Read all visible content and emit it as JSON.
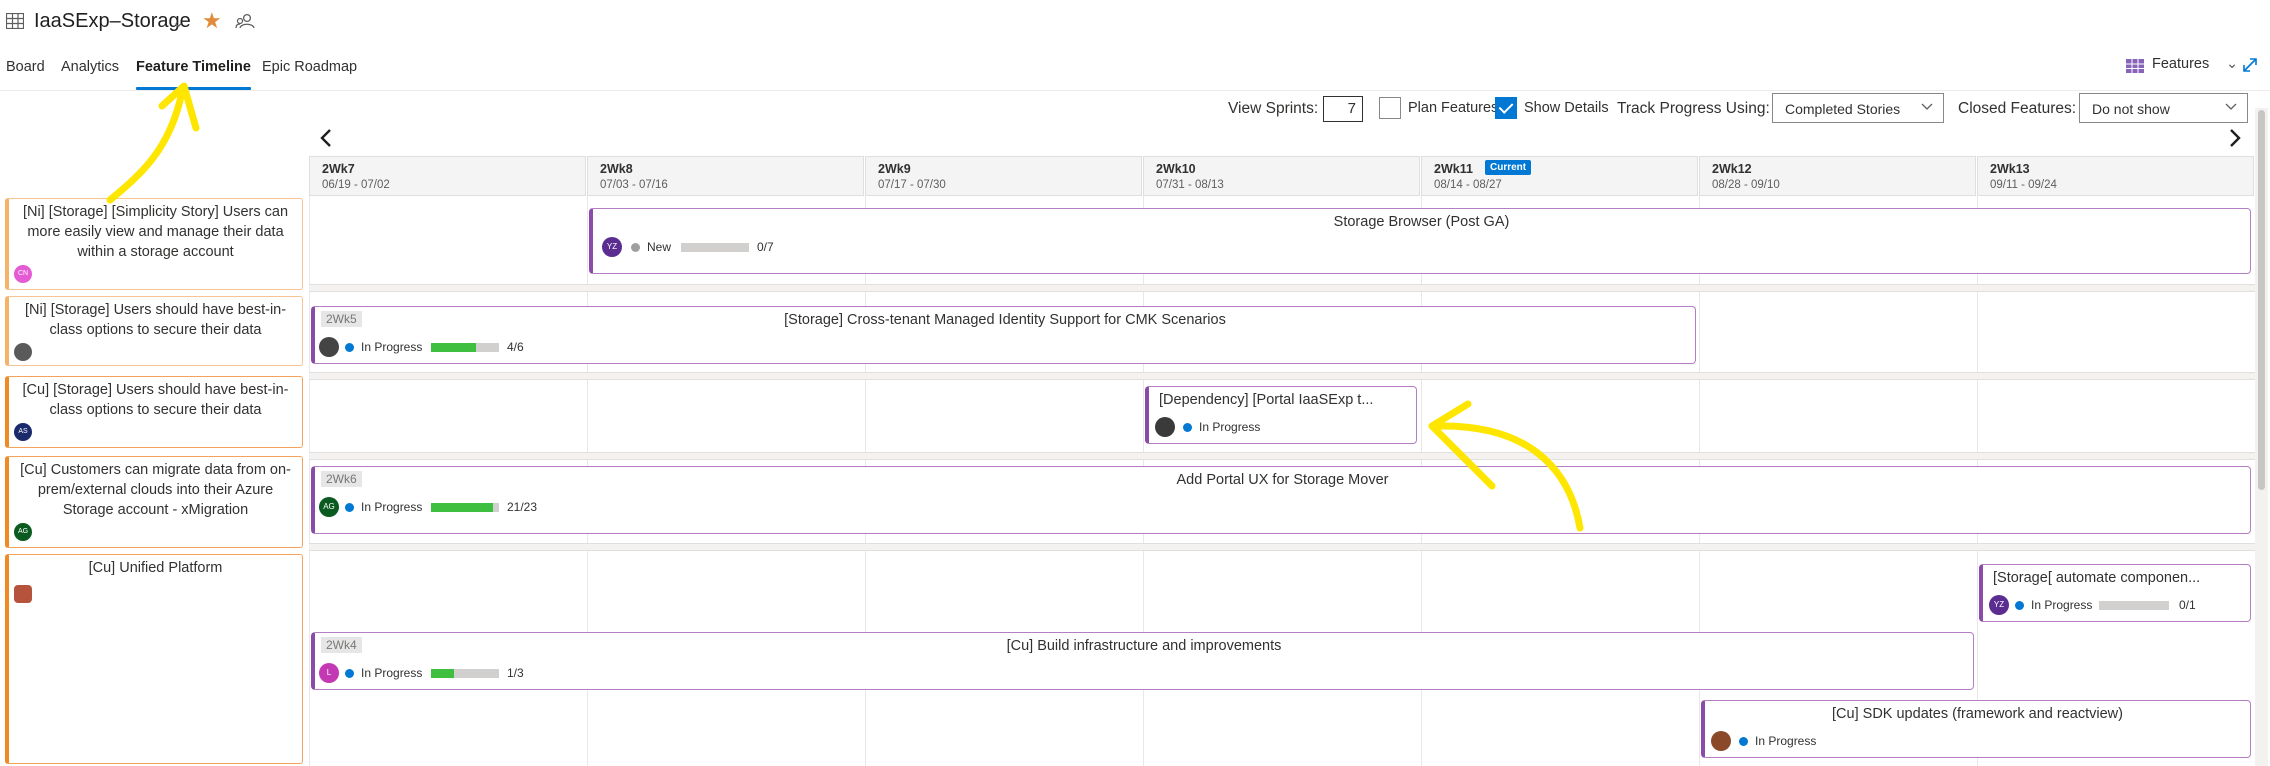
{
  "header": {
    "team_name": "IaaSExp–Storage",
    "tabs": [
      {
        "label": "Board"
      },
      {
        "label": "Analytics"
      },
      {
        "label": "Feature Timeline"
      },
      {
        "label": "Epic Roadmap"
      }
    ],
    "backlog_level": "Features"
  },
  "toolbar": {
    "view_sprints_label": "View Sprints:",
    "view_sprints_value": "7",
    "plan_features_label": "Plan Features",
    "plan_features_checked": false,
    "show_details_label": "Show Details",
    "show_details_checked": true,
    "track_progress_label": "Track Progress Using:",
    "track_progress_value": "Completed Stories",
    "closed_features_label": "Closed Features:",
    "closed_features_value": "Do not show"
  },
  "sprints": [
    {
      "name": "2Wk7",
      "dates": "06/19 - 07/02"
    },
    {
      "name": "2Wk8",
      "dates": "07/03 - 07/16"
    },
    {
      "name": "2Wk9",
      "dates": "07/17 - 07/30"
    },
    {
      "name": "2Wk10",
      "dates": "07/31 - 08/13"
    },
    {
      "name": "2Wk11",
      "dates": "08/14 - 08/27",
      "badge": "Current"
    },
    {
      "name": "2Wk12",
      "dates": "08/28 - 09/10"
    },
    {
      "name": "2Wk13",
      "dates": "09/11 - 09/24"
    }
  ],
  "epics": [
    {
      "title": "[Ni] [Storage] [Simplicity Story] Users can more easily view and manage their data within a storage account",
      "avatar": "CN",
      "avatar_color": "#e45bd4"
    },
    {
      "title": "[Ni] [Storage] Users should have best-in-class options to secure their data",
      "avatar": "",
      "avatar_color": "#5a5a5a"
    },
    {
      "title": "[Cu] [Storage] Users should have best-in-class options to secure their data",
      "avatar": "AS",
      "avatar_color": "#1b2a6b"
    },
    {
      "title": "[Cu] Customers can migrate data from on-prem/external clouds into their Azure Storage account - xMigration",
      "avatar": "AG",
      "avatar_color": "#0b5a1f"
    },
    {
      "title": "[Cu] Unified Platform",
      "avatar": "",
      "avatar_color": "#b5533c"
    }
  ],
  "features": [
    {
      "title": "Storage Browser (Post GA)",
      "sprint_tag": "",
      "state": "New",
      "state_color": "#a19f9d",
      "progress_text": "0/7",
      "progress": 0,
      "avatar": "YZ",
      "avatar_color": "#5c2d91"
    },
    {
      "title": "[Storage] Cross-tenant Managed Identity Support for CMK Scenarios",
      "sprint_tag": "2Wk5",
      "state": "In Progress",
      "state_color": "#0078d4",
      "progress_text": "4/6",
      "progress": 0.667,
      "avatar": "",
      "avatar_color": "#444444"
    },
    {
      "title": "[Dependency] [Portal IaaSExp t...",
      "sprint_tag": "",
      "state": "In Progress",
      "state_color": "#0078d4",
      "progress_text": "",
      "progress": null,
      "avatar": "",
      "avatar_color": "#3a3a3a"
    },
    {
      "title": "Add Portal UX for Storage Mover",
      "sprint_tag": "2Wk6",
      "state": "In Progress",
      "state_color": "#0078d4",
      "progress_text": "21/23",
      "progress": 0.913,
      "avatar": "AG",
      "avatar_color": "#0b5a1f"
    },
    {
      "title": "[Storage[ automate componen...",
      "sprint_tag": "",
      "state": "In Progress",
      "state_color": "#0078d4",
      "progress_text": "0/1",
      "progress": 0,
      "avatar": "YZ",
      "avatar_color": "#5c2d91"
    },
    {
      "title": "[Cu] Build infrastructure and improvements",
      "sprint_tag": "2Wk4",
      "state": "In Progress",
      "state_color": "#0078d4",
      "progress_text": "1/3",
      "progress": 0.333,
      "avatar": "L",
      "avatar_color": "#c239b3"
    },
    {
      "title": "[Cu] SDK updates (framework and reactview)",
      "sprint_tag": "",
      "state": "In Progress",
      "state_color": "#0078d4",
      "progress_text": "",
      "progress": null,
      "avatar": "",
      "avatar_color": "#8a4a2a"
    }
  ],
  "colors": {
    "accent": "#0078d4",
    "favorite": "#e08c3c",
    "epic_border": "#f6b26b",
    "feature_border": "#8b4ba8",
    "progress": "#3fbf3f",
    "annotation": "#ffe600"
  }
}
